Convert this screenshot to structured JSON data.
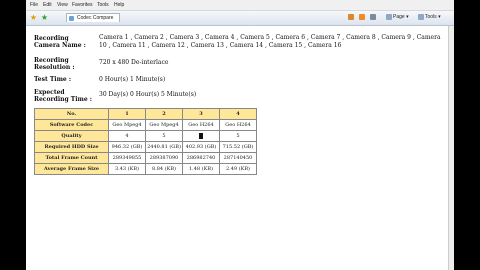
{
  "menu": [
    "File",
    "Edit",
    "View",
    "Favorites",
    "Tools",
    "Help"
  ],
  "toolbar": {
    "tab_title": "Codec Compare",
    "page_label": "Page",
    "tools_label": "Tools"
  },
  "info": {
    "recording_camera_label": "Recording Camera Name :",
    "recording_camera_value": "Camera 1 , Camera 2 , Camera 3 , Camera 4 , Camera 5 , Camera 6 , Camera 7 , Camera 8 , Camera 9 , Camera 10 , Camera 11 , Camera 12 , Camera 13 , Camera 14 , Camera 15 , Camera 16",
    "resolution_label": "Recording Resolution :",
    "resolution_value": "720 x 480 De-interlace",
    "test_time_label": "Test Time :",
    "test_time_value": "0 Hour(s) 1 Minute(s)",
    "expected_label": "Expected Recording Time :",
    "expected_value": "30 Day(s) 0 Hour(s) 5 Minute(s)"
  },
  "table": {
    "header_no": "No.",
    "columns": [
      "1",
      "2",
      "3",
      "4"
    ],
    "rows": [
      {
        "label": "Software Codec",
        "values": [
          "Geo Mpeg4",
          "Geo Mpeg4",
          "Geo H264",
          "Geo H264"
        ]
      },
      {
        "label": "Quality",
        "values": [
          "4",
          "5",
          "",
          "5"
        ]
      },
      {
        "label": "Required HDD Size",
        "values": [
          "946.32 (GB)",
          "2440.81 (GB)",
          "402.93 (GB)",
          "715.52 (GB)"
        ]
      },
      {
        "label": "Total Frame Count",
        "values": [
          "289349855",
          "289387090",
          "286982740",
          "287140450"
        ]
      },
      {
        "label": "Average Frame Size",
        "values": [
          "3.43 (KB)",
          "8.84 (KB)",
          "1.48 (KB)",
          "2.49 (KB)"
        ]
      }
    ]
  }
}
